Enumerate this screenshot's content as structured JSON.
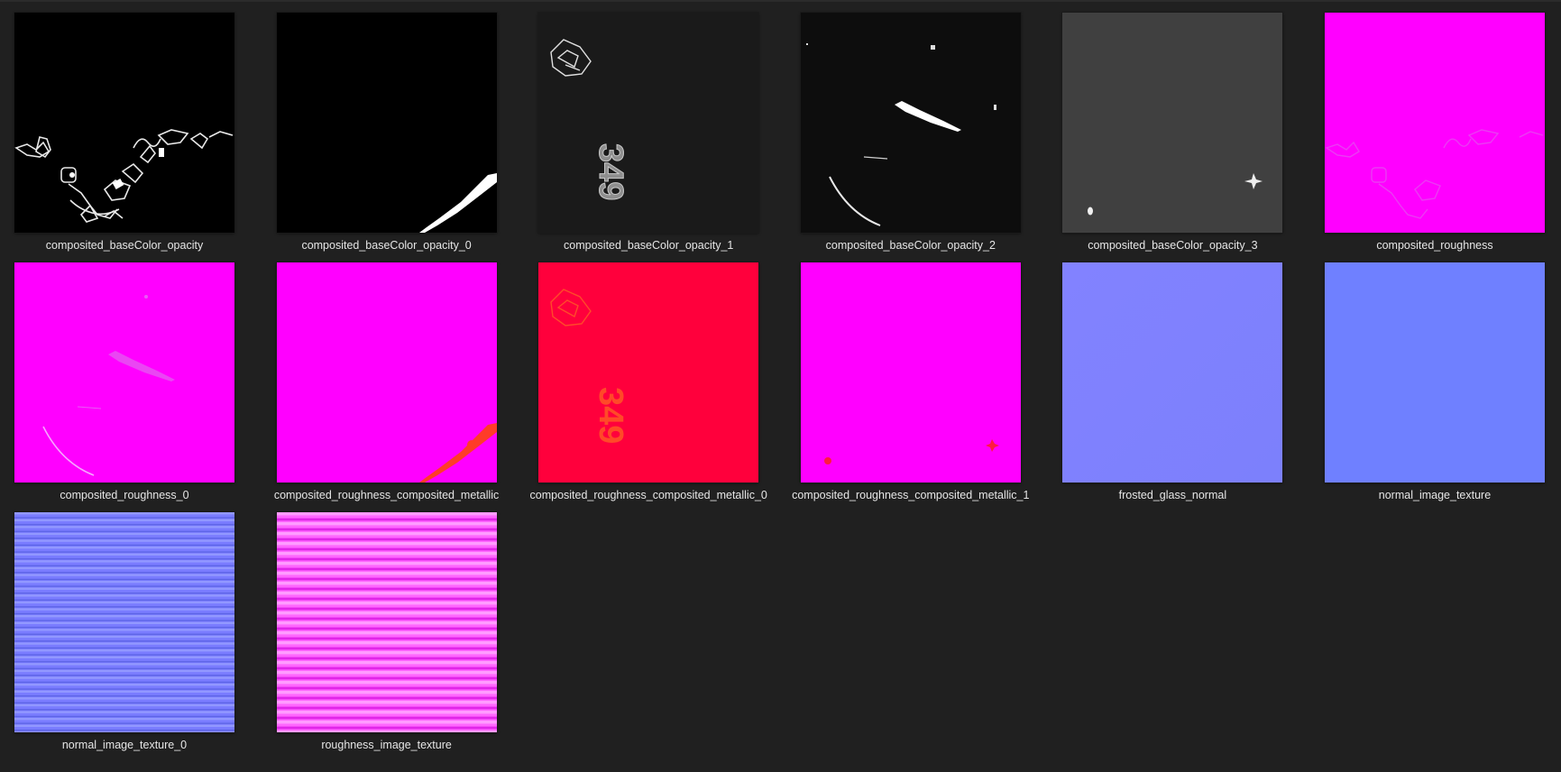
{
  "files": [
    {
      "name": "composited_baseColor_opacity",
      "thumb": "black-decals-cluster",
      "bg": "#000000"
    },
    {
      "name": "composited_baseColor_opacity_0",
      "thumb": "black-corner-stripe",
      "bg": "#000000"
    },
    {
      "name": "composited_baseColor_opacity_1",
      "thumb": "dark-number-349",
      "bg": "#1a1a1a"
    },
    {
      "name": "composited_baseColor_opacity_2",
      "thumb": "dark-streaks",
      "bg": "#0d0d0d"
    },
    {
      "name": "composited_baseColor_opacity_3",
      "thumb": "gray-sparkle",
      "bg": "#404040"
    },
    {
      "name": "composited_roughness",
      "thumb": "magenta-faint-decals",
      "bg": "#ff00ff"
    },
    {
      "name": "composited_roughness_0",
      "thumb": "magenta-faint-streaks",
      "bg": "#ff00ff"
    },
    {
      "name": "composited_roughness_composited_metallic",
      "thumb": "magenta-orange-stripe",
      "bg": "#ff00ff"
    },
    {
      "name": "composited_roughness_composited_metallic_0",
      "thumb": "red-number-349",
      "bg": "#ff003c"
    },
    {
      "name": "composited_roughness_composited_metallic_1",
      "thumb": "magenta-red-dots",
      "bg": "#ff00ff"
    },
    {
      "name": "frosted_glass_normal",
      "thumb": "lavender-flat",
      "bg": "#8080ff"
    },
    {
      "name": "normal_image_texture",
      "thumb": "blue-flat",
      "bg": "#6f80ff"
    },
    {
      "name": "normal_image_texture_0",
      "thumb": "blue-stripes",
      "bg": "#7a7cff"
    },
    {
      "name": "roughness_image_texture",
      "thumb": "pink-stripes",
      "bg": "#ff66ff"
    }
  ],
  "thumb_text": {
    "number": "349"
  }
}
